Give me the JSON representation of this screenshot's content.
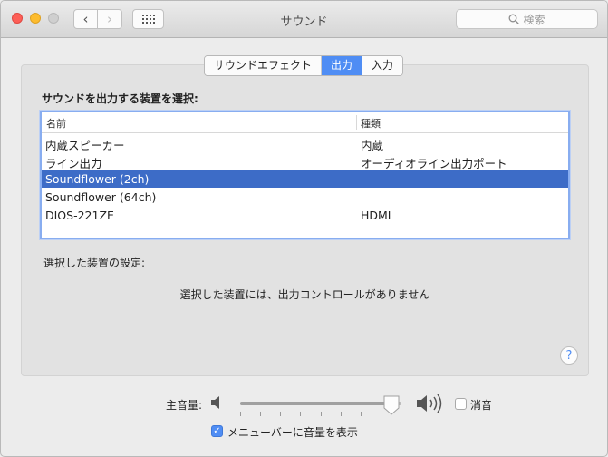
{
  "window": {
    "title": "サウンド"
  },
  "search": {
    "placeholder": "検索"
  },
  "tabs": [
    {
      "label": "サウンドエフェクト",
      "active": false
    },
    {
      "label": "出力",
      "active": true
    },
    {
      "label": "入力",
      "active": false
    }
  ],
  "output": {
    "select_label": "サウンドを出力する装置を選択:",
    "columns": {
      "name": "名前",
      "type": "種類"
    },
    "devices": [
      {
        "name": "内蔵スピーカー",
        "type": "内蔵",
        "selected": false
      },
      {
        "name": "ライン出力",
        "type": "オーディオライン出力ポート",
        "selected": false
      },
      {
        "name": "Soundflower (2ch)",
        "type": "",
        "selected": true
      },
      {
        "name": "Soundflower (64ch)",
        "type": "",
        "selected": false
      },
      {
        "name": "DIOS-221ZE",
        "type": "HDMI",
        "selected": false
      }
    ],
    "settings_label": "選択した装置の設定:",
    "no_controls_message": "選択した装置には、出力コントロールがありません"
  },
  "help": {
    "glyph": "?"
  },
  "volume": {
    "label": "主音量:",
    "level": 0.94,
    "mute_label": "消音",
    "muted": false,
    "show_in_menubar_label": "メニューバーに音量を表示",
    "show_in_menubar": true
  },
  "colors": {
    "accent": "#4f8df4",
    "selection": "#3d6cc7"
  }
}
